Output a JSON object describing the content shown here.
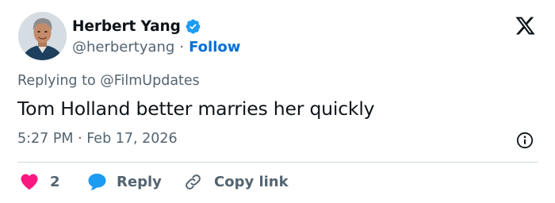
{
  "tweet": {
    "author": {
      "display_name": "Herbert Yang",
      "handle": "@herbertyang",
      "separator": "·",
      "follow_label": "Follow",
      "verified": true
    },
    "reply_to_prefix": "Replying to ",
    "reply_to_handle": "@FilmUpdates",
    "text": "Tom Holland better marries her quickly",
    "timestamp": "5:27 PM · Feb 17, 2026",
    "actions": {
      "like_count": "2",
      "reply_label": "Reply",
      "copy_link_label": "Copy link"
    }
  },
  "icons": {
    "verified": "verified-badge-icon",
    "brand": "x-logo-icon",
    "info": "info-icon",
    "like": "heart-icon",
    "reply": "speech-bubble-icon",
    "copy_link": "link-icon"
  },
  "colors": {
    "text_primary": "#0f1419",
    "text_secondary": "#536471",
    "link_blue": "#006fd6",
    "verified_blue": "#1d9bf0",
    "like_pink": "#f91880",
    "divider": "#cfd9de"
  }
}
